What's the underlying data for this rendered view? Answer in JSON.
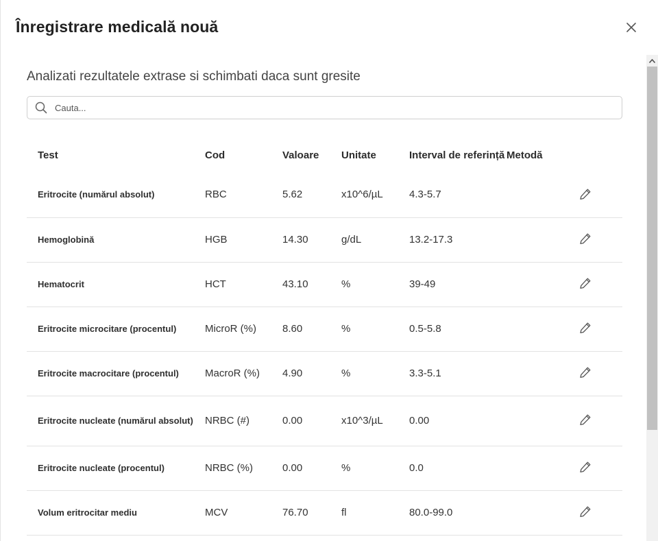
{
  "dialog": {
    "title": "Înregistrare medicală nouă",
    "close_label": "Close"
  },
  "subtitle": "Analizati rezultatele extrase si schimbati daca sunt gresite",
  "search": {
    "placeholder": "Cauta...",
    "value": ""
  },
  "table": {
    "headers": {
      "test": "Test",
      "code": "Cod",
      "value": "Valoare",
      "unit": "Unitate",
      "reference": "Interval de referință",
      "method": "Metodă"
    },
    "rows": [
      {
        "test": "Eritrocite (numărul absolut)",
        "code": "RBC",
        "value": "5.62",
        "unit": "x10^6/µL",
        "reference": "4.3-5.7",
        "method": ""
      },
      {
        "test": "Hemoglobină",
        "code": "HGB",
        "value": "14.30",
        "unit": "g/dL",
        "reference": "13.2-17.3",
        "method": ""
      },
      {
        "test": "Hematocrit",
        "code": "HCT",
        "value": "43.10",
        "unit": "%",
        "reference": "39-49",
        "method": ""
      },
      {
        "test": "Eritrocite microcitare (procentul)",
        "code": "MicroR (%)",
        "value": "8.60",
        "unit": "%",
        "reference": "0.5-5.8",
        "method": ""
      },
      {
        "test": "Eritrocite macrocitare (procentul)",
        "code": "MacroR (%)",
        "value": "4.90",
        "unit": "%",
        "reference": "3.3-5.1",
        "method": ""
      },
      {
        "test": "Eritrocite nucleate (numărul absolut)",
        "code": "NRBC (#)",
        "value": "0.00",
        "unit": "x10^3/µL",
        "reference": "0.00",
        "method": ""
      },
      {
        "test": "Eritrocite nucleate (procentul)",
        "code": "NRBC (%)",
        "value": "0.00",
        "unit": "%",
        "reference": "0.0",
        "method": ""
      },
      {
        "test": "Volum eritrocitar mediu",
        "code": "MCV",
        "value": "76.70",
        "unit": "fl",
        "reference": "80.0-99.0",
        "method": ""
      }
    ]
  },
  "icons": {
    "close": "close-icon",
    "search": "search-icon",
    "edit": "pencil-icon",
    "scroll_up": "chevron-up-icon"
  },
  "colors": {
    "title": "#222222",
    "border": "#cfcfcf",
    "row_divider": "#e2e2e2",
    "scroll_thumb": "#c1c1c1"
  }
}
